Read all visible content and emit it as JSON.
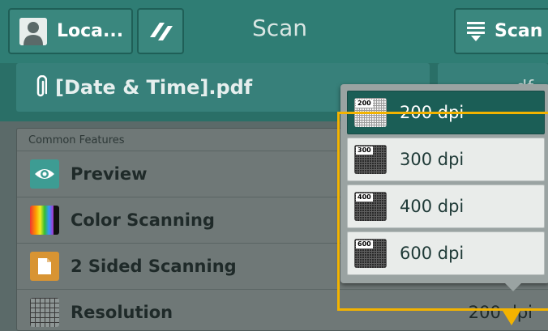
{
  "header": {
    "local_label": "Loca...",
    "title": "Scan",
    "scan_label": "Scan"
  },
  "file": {
    "name": "[Date & Time].pdf",
    "type_fragment": "df"
  },
  "features": {
    "header": "Common Features",
    "rows": [
      {
        "label": "Preview",
        "icon": "eye-icon"
      },
      {
        "label": "Color Scanning",
        "icon": "color-bars-icon"
      },
      {
        "label": "2 Sided Scanning",
        "icon": "two-sided-icon"
      },
      {
        "label": "Resolution",
        "icon": "grid-icon",
        "value": "200 dpi"
      }
    ]
  },
  "resolution_menu": {
    "options": [
      {
        "badge": "200",
        "label": "200 dpi",
        "selected": true
      },
      {
        "badge": "300",
        "label": "300 dpi",
        "selected": false
      },
      {
        "badge": "400",
        "label": "400 dpi",
        "selected": false
      },
      {
        "badge": "600",
        "label": "600 dpi",
        "selected": false
      }
    ]
  },
  "colors": {
    "accent": "#2f7d74",
    "selected": "#1b5e56",
    "highlight": "#f3b300"
  }
}
